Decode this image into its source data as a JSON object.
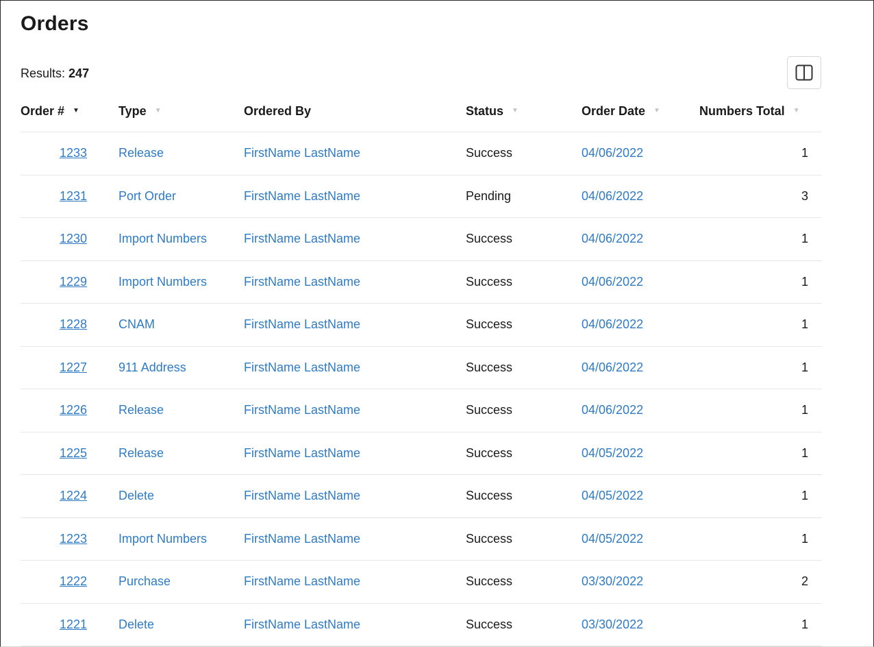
{
  "page": {
    "title": "Orders",
    "results_label": "Results:",
    "results_count": "247"
  },
  "toolbar": {
    "columns_button_icon": "columns-icon"
  },
  "table": {
    "columns": [
      {
        "label": "Order #",
        "sort": "desc-active"
      },
      {
        "label": "Type",
        "sort": "inactive"
      },
      {
        "label": "Ordered By",
        "sort": "none"
      },
      {
        "label": "Status",
        "sort": "inactive"
      },
      {
        "label": "Order Date",
        "sort": "inactive"
      },
      {
        "label": "Numbers Total",
        "sort": "inactive"
      }
    ],
    "rows": [
      {
        "order": "1233",
        "type": "Release",
        "ordered_by": "FirstName LastName",
        "status": "Success",
        "date": "04/06/2022",
        "total": "1"
      },
      {
        "order": "1231",
        "type": "Port Order",
        "ordered_by": "FirstName LastName",
        "status": "Pending",
        "date": "04/06/2022",
        "total": "3"
      },
      {
        "order": "1230",
        "type": "Import Numbers",
        "ordered_by": "FirstName LastName",
        "status": "Success",
        "date": "04/06/2022",
        "total": "1"
      },
      {
        "order": "1229",
        "type": "Import Numbers",
        "ordered_by": "FirstName LastName",
        "status": "Success",
        "date": "04/06/2022",
        "total": "1"
      },
      {
        "order": "1228",
        "type": "CNAM",
        "ordered_by": "FirstName LastName",
        "status": "Success",
        "date": "04/06/2022",
        "total": "1"
      },
      {
        "order": "1227",
        "type": "911 Address",
        "ordered_by": "FirstName LastName",
        "status": "Success",
        "date": "04/06/2022",
        "total": "1"
      },
      {
        "order": "1226",
        "type": "Release",
        "ordered_by": "FirstName LastName",
        "status": "Success",
        "date": "04/06/2022",
        "total": "1"
      },
      {
        "order": "1225",
        "type": "Release",
        "ordered_by": "FirstName LastName",
        "status": "Success",
        "date": "04/05/2022",
        "total": "1"
      },
      {
        "order": "1224",
        "type": "Delete",
        "ordered_by": "FirstName LastName",
        "status": "Success",
        "date": "04/05/2022",
        "total": "1"
      },
      {
        "order": "1223",
        "type": "Import Numbers",
        "ordered_by": "FirstName LastName",
        "status": "Success",
        "date": "04/05/2022",
        "total": "1"
      },
      {
        "order": "1222",
        "type": "Purchase",
        "ordered_by": "FirstName LastName",
        "status": "Success",
        "date": "03/30/2022",
        "total": "2"
      },
      {
        "order": "1221",
        "type": "Delete",
        "ordered_by": "FirstName LastName",
        "status": "Success",
        "date": "03/30/2022",
        "total": "1"
      }
    ]
  },
  "colors": {
    "link": "#2f7bc4",
    "text": "#1a1a1a",
    "divider": "#e6e6e6",
    "sort_inactive": "#c4c4c4"
  }
}
